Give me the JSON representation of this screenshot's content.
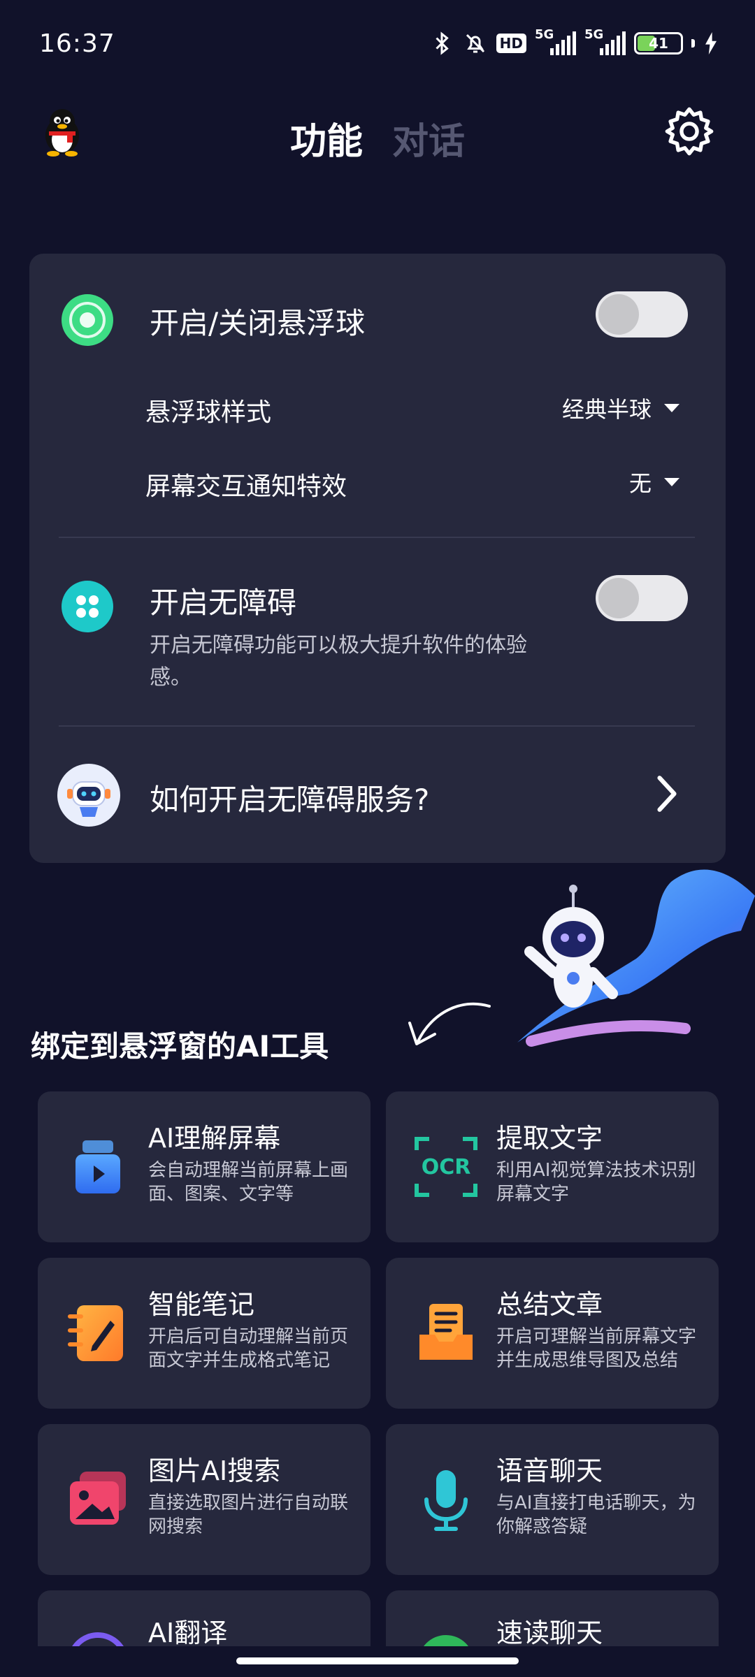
{
  "status_bar": {
    "time": "16:37",
    "hd_label": "HD",
    "network_1": "5G",
    "network_2": "5G",
    "battery_level": "41",
    "battery_percent": 41,
    "icons": [
      "bluetooth-icon",
      "mute-bell-icon",
      "charging-icon"
    ]
  },
  "header": {
    "tabs": [
      {
        "label": "功能",
        "active": true
      },
      {
        "label": "对话",
        "active": false
      }
    ],
    "settings_icon": "gear-icon",
    "avatar_icon": "qq-penguin-icon"
  },
  "settings": {
    "floating_ball": {
      "title": "开启/关闭悬浮球",
      "enabled": false,
      "style_label": "悬浮球样式",
      "style_value": "经典半球",
      "effect_label": "屏幕交互通知特效",
      "effect_value": "无"
    },
    "accessibility": {
      "title": "开启无障碍",
      "enabled": false,
      "description_line1": "开启无障碍功能可以极大提升软件的体验",
      "description_line2": "感。"
    },
    "help": {
      "title": "如何开启无障碍服务?"
    }
  },
  "tools_section": {
    "title": "绑定到悬浮窗的AI工具",
    "tools": [
      {
        "title": "AI理解屏幕",
        "desc": "会自动理解当前屏幕上画面、图案、文字等",
        "icon": "screen-play-icon"
      },
      {
        "title": "提取文字",
        "desc": "利用AI视觉算法技术识别屏幕文字",
        "icon": "ocr-icon",
        "icon_text": "OCR"
      },
      {
        "title": "智能笔记",
        "desc": "开启后可自动理解当前页面文字并生成格式笔记",
        "icon": "notebook-pen-icon"
      },
      {
        "title": "总结文章",
        "desc": "开启可理解当前屏幕文字并生成思维导图及总结",
        "icon": "document-tray-icon"
      },
      {
        "title": "图片AI搜索",
        "desc": "直接选取图片进行自动联网搜索",
        "icon": "image-search-icon"
      },
      {
        "title": "语音聊天",
        "desc": "与AI直接打电话聊天，为你解惑答疑",
        "icon": "microphone-icon"
      },
      {
        "title": "AI翻译",
        "desc": "",
        "icon": "translate-icon"
      },
      {
        "title": "速读聊天",
        "desc": "",
        "icon": "speed-read-icon"
      }
    ]
  },
  "colors": {
    "background": "#11122a",
    "card": "#26283d",
    "inactive_tab": "#565872",
    "green_accent": "#3ddc84",
    "teal_accent": "#1ec9c9"
  }
}
